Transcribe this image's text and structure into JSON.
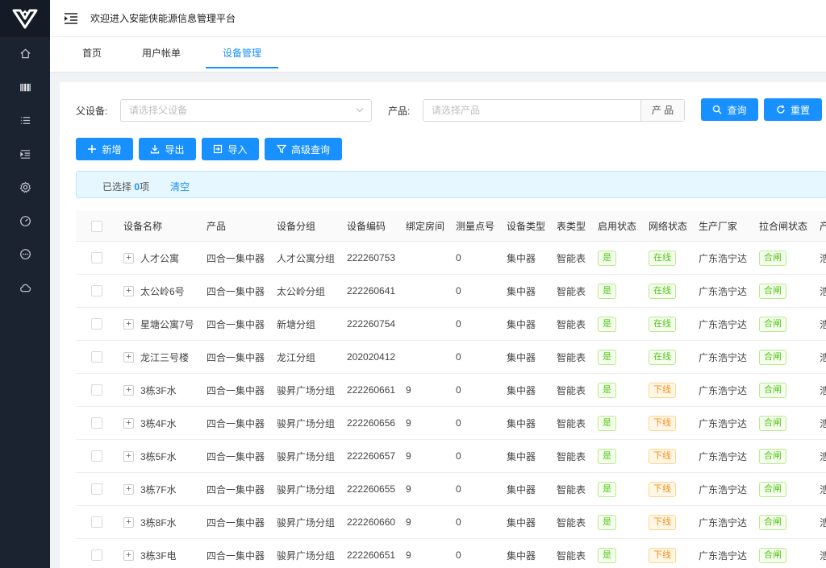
{
  "header": {
    "welcome": "欢迎进入安能侠能源信息管理平台"
  },
  "tabs": [
    "首页",
    "用户帐单",
    "设备管理"
  ],
  "filters": {
    "parent_label": "父设备:",
    "parent_placeholder": "请选择父设备",
    "product_label": "产品:",
    "product_placeholder": "请选择产品",
    "product_addon": "产 品"
  },
  "buttons": {
    "search": "查询",
    "reset": "重置",
    "add": "新增",
    "export": "导出",
    "import": "导入",
    "advanced": "高级查询"
  },
  "alert": {
    "prefix": "已选择 ",
    "count": "0",
    "suffix": "项",
    "clear": "清空"
  },
  "table": {
    "columns": [
      "设备名称",
      "产品",
      "设备分组",
      "设备编码",
      "绑定房间",
      "测量点号",
      "设备类型",
      "表类型",
      "启用状态",
      "网络状态",
      "生产厂家",
      "拉合闸状态",
      "产"
    ],
    "rows": [
      {
        "name": "人才公寓",
        "product": "四合一集中器",
        "group": "人才公寓分组",
        "code": "222260753",
        "room": "",
        "point": "0",
        "dtype": "集中器",
        "mtype": "智能表",
        "enabled": "是",
        "network": "在线",
        "maker": "广东浩宁达",
        "switch": "合闸",
        "extra": "浩"
      },
      {
        "name": "太公岭6号",
        "product": "四合一集中器",
        "group": "太公岭分组",
        "code": "222260641",
        "room": "",
        "point": "0",
        "dtype": "集中器",
        "mtype": "智能表",
        "enabled": "是",
        "network": "在线",
        "maker": "广东浩宁达",
        "switch": "合闸",
        "extra": "浩"
      },
      {
        "name": "星塘公寓7号",
        "product": "四合一集中器",
        "group": "新塘分组",
        "code": "222260754",
        "room": "",
        "point": "0",
        "dtype": "集中器",
        "mtype": "智能表",
        "enabled": "是",
        "network": "在线",
        "maker": "广东浩宁达",
        "switch": "合闸",
        "extra": "浩"
      },
      {
        "name": "龙江三号楼",
        "product": "四合一集中器",
        "group": "龙江分组",
        "code": "202020412",
        "room": "",
        "point": "0",
        "dtype": "集中器",
        "mtype": "智能表",
        "enabled": "是",
        "network": "在线",
        "maker": "广东浩宁达",
        "switch": "合闸",
        "extra": "浩"
      },
      {
        "name": "3栋3F水",
        "product": "四合一集中器",
        "group": "骏昇广场分组",
        "code": "222260661",
        "room": "9",
        "point": "0",
        "dtype": "集中器",
        "mtype": "智能表",
        "enabled": "是",
        "network": "下线",
        "maker": "广东浩宁达",
        "switch": "合闸",
        "extra": "浩"
      },
      {
        "name": "3栋4F水",
        "product": "四合一集中器",
        "group": "骏昇广场分组",
        "code": "222260656",
        "room": "9",
        "point": "0",
        "dtype": "集中器",
        "mtype": "智能表",
        "enabled": "是",
        "network": "下线",
        "maker": "广东浩宁达",
        "switch": "合闸",
        "extra": "浩"
      },
      {
        "name": "3栋5F水",
        "product": "四合一集中器",
        "group": "骏昇广场分组",
        "code": "222260657",
        "room": "9",
        "point": "0",
        "dtype": "集中器",
        "mtype": "智能表",
        "enabled": "是",
        "network": "下线",
        "maker": "广东浩宁达",
        "switch": "合闸",
        "extra": "浩"
      },
      {
        "name": "3栋7F水",
        "product": "四合一集中器",
        "group": "骏昇广场分组",
        "code": "222260655",
        "room": "9",
        "point": "0",
        "dtype": "集中器",
        "mtype": "智能表",
        "enabled": "是",
        "network": "下线",
        "maker": "广东浩宁达",
        "switch": "合闸",
        "extra": "浩"
      },
      {
        "name": "3栋8F水",
        "product": "四合一集中器",
        "group": "骏昇广场分组",
        "code": "222260660",
        "room": "9",
        "point": "0",
        "dtype": "集中器",
        "mtype": "智能表",
        "enabled": "是",
        "network": "下线",
        "maker": "广东浩宁达",
        "switch": "合闸",
        "extra": "浩"
      },
      {
        "name": "3栋3F电",
        "product": "四合一集中器",
        "group": "骏昇广场分组",
        "code": "222260651",
        "room": "9",
        "point": "0",
        "dtype": "集中器",
        "mtype": "智能表",
        "enabled": "是",
        "network": "下线",
        "maker": "广东浩宁达",
        "switch": "合闸",
        "extra": "浩"
      }
    ]
  },
  "colors": {
    "primary": "#1890ff",
    "sidebar": "#1c2330",
    "online": "#52c41a",
    "offline": "#fa8c16"
  },
  "icons": [
    "logo-icon",
    "home-icon",
    "barcode-icon",
    "list-icon",
    "indent-icon",
    "settings-icon",
    "dashboard-icon",
    "chat-icon",
    "cloud-icon",
    "menu-fold-icon",
    "search-icon",
    "reload-icon",
    "plus-icon",
    "download-icon",
    "import-icon",
    "filter-icon"
  ]
}
